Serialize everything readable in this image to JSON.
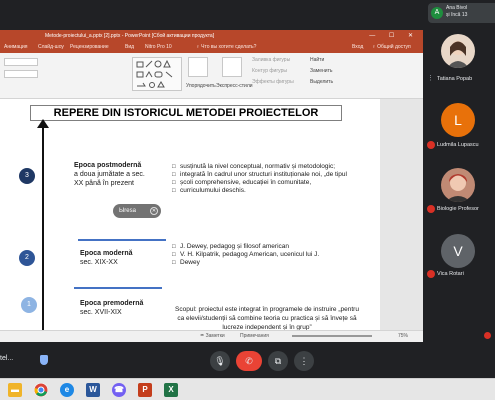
{
  "banner": {
    "name": "Ana Bivol",
    "sub": "și încă 13",
    "avatar": "A"
  },
  "ppt": {
    "title": "Metode-proiectului_a.pptx [2].pptx - PowerPoint [Сбой активации продукта]",
    "window_controls": "— ☐ ✕",
    "tabs": [
      "Анимация",
      "Слайд-шоу",
      "Рецензирование",
      "Вид",
      "Nitro Pro 10",
      "♀ Что вы хотите сделать?",
      "Вход",
      "♀ Общий доступ"
    ],
    "ribbon": {
      "arrange": "Упорядочить",
      "quick_styles": "Экспресс-стили",
      "fill": "Заливка фигуры",
      "outline": "Контур фигуры",
      "effects": "Эффекты фигуры",
      "find": "Найти",
      "replace": "Заменить",
      "select": "Выделить"
    },
    "status": {
      "notes": "≐ Заметки",
      "comments": "Примечания",
      "zoom": "75%"
    }
  },
  "slide": {
    "title": "REPERE DIN ISTORICUL METODEI PROIECTELOR",
    "numbers": [
      "3",
      "2",
      "1"
    ],
    "eras": [
      {
        "name": "Epoca postmodernă",
        "line2": "a doua jumătate a sec.",
        "line3": "XX până în prezent"
      },
      {
        "name": "Epoca modernă",
        "line2": "sec. XIX-XX"
      },
      {
        "name": "Epoca premodernă",
        "line2": "sec. XVII-XIX"
      }
    ],
    "bullets_top": [
      "susținută la nivel conceptual, normativ și metodologic;",
      "integrată în cadrul unor structuri instituționale noi, „de tipul",
      "școli comprehensive, educației în comunitate,",
      "curriculumului deschis."
    ],
    "bullets_mid": [
      "J. Dewey, pedagog și filosof american",
      "V. H. Kilpatrik, pedagog American, ucenicul lui J.",
      "Dewey"
    ],
    "scope": "Scopul: proiectul este integrat în programele de instruire „pentru ca elevii/studenții să combine teoria cu practica și să învețe să lucreze independent și în grup”",
    "pill": "Ыresa"
  },
  "participants": [
    {
      "name": "Tatiana Popab",
      "initial": "",
      "color": "#e8d7c8"
    },
    {
      "name": "Ludmila Lupascu",
      "initial": "L",
      "color": "#e8710a"
    },
    {
      "name": "Biologie Profesor",
      "initial": "",
      "color": "#c08a74"
    },
    {
      "name": "Vica Rotari",
      "initial": "V",
      "color": "#5f6368"
    }
  ],
  "controls": {
    "meeting": "tel...",
    "mic": "🎙",
    "cam": "▭",
    "end": "✆",
    "cc": "⧉",
    "more": "⋮"
  },
  "colors": {
    "ppt_red": "#b7472a",
    "num_dark": "#1f3864",
    "num_mid": "#2e5597",
    "num_light": "#8eb4e3",
    "sep": "#4472c4"
  }
}
